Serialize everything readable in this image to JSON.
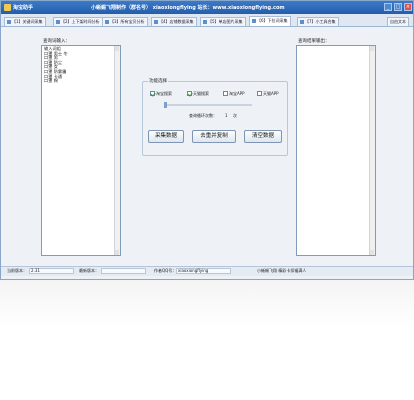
{
  "window": {
    "app_name": "淘宝助手",
    "headline": "小蜥蜴飞翔制作（群名号）   xiaoxiongflying    站长：www.xiaoxiongflying.com",
    "controls": [
      "_",
      "□",
      "×"
    ]
  },
  "tabs": [
    {
      "label": "【1】关键词采集"
    },
    {
      "label": "【2】上下架时间分析"
    },
    {
      "label": "【3】所有宝贝分析"
    },
    {
      "label": "【4】店铺数据采集"
    },
    {
      "label": "【5】单店图片采集"
    },
    {
      "label": "【6】下拉词采集"
    },
    {
      "label": "【7】小工具合集"
    },
    {
      "label": "自由文本"
    }
  ],
  "left_panel": {
    "label": "查询词输入：",
    "lines": [
      "输入词组",
      "口罩 男士 冬",
      "口罩 男",
      "口罩 防尘",
      "口罩 女",
      "口罩 防雾霾",
      "口罩 卡通",
      "口罩 棉"
    ]
  },
  "right_panel": {
    "label": "查询结果输出："
  },
  "options": {
    "group_title": "功能选择",
    "checkboxes": [
      {
        "label": "淘宝搜索",
        "checked": true
      },
      {
        "label": "天猫搜索",
        "checked": true
      },
      {
        "label": "淘宝APP",
        "checked": false
      },
      {
        "label": "天猫APP",
        "checked": false
      }
    ],
    "repeat_label": "查询循环次数：",
    "repeat_value": "1",
    "repeat_unit": "次"
  },
  "buttons": {
    "collect": "采集数据",
    "dedupe_copy": "去重并复制",
    "clear": "清空数据"
  },
  "status": {
    "version_label": "当前版本：",
    "version_value": "2.31",
    "latest_label": "最新版本：",
    "latest_value": "",
    "qq_label": "作者QQ号：",
    "qq_value": "xiaoxiongflying",
    "author_note": "小蜥蜴飞翔  精彩卡扣福满人"
  }
}
